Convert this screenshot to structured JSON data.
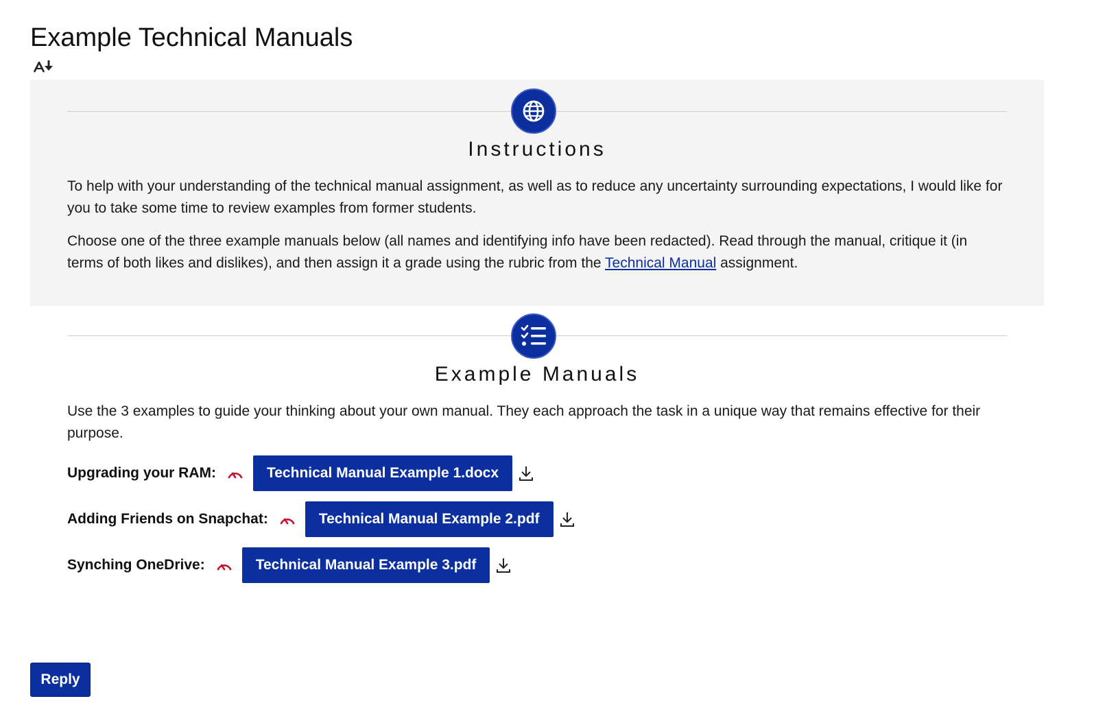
{
  "page": {
    "title": "Example Technical Manuals"
  },
  "icons": {
    "accessibility": "immersive-reader-icon",
    "instructions": "globe-icon",
    "examples": "checklist-icon",
    "preview": "preview-icon",
    "download": "download-icon"
  },
  "instructions": {
    "heading": "Instructions",
    "paragraph1": "To help with your understanding of the technical manual assignment, as well as to reduce any uncertainty surrounding expectations, I would like for you to take some time to review examples from former students.",
    "paragraph2_before": "Choose one of the three example manuals below (all names and identifying info have been redacted). Read through the manual, critique it (in terms of both likes and dislikes), and then assign it a grade using the rubric from the ",
    "paragraph2_link": "Technical Manual",
    "paragraph2_after": " assignment."
  },
  "examples": {
    "heading": "Example Manuals",
    "intro": "Use the 3 examples to guide your thinking about your own manual. They each approach the task in a unique way that remains effective for their purpose.",
    "files": [
      {
        "label": "Upgrading your RAM:",
        "file": "Technical Manual Example 1.docx"
      },
      {
        "label": "Adding Friends on Snapchat:",
        "file": "Technical Manual Example 2.pdf"
      },
      {
        "label": "Synching OneDrive:",
        "file": "Technical Manual Example 3.pdf"
      }
    ]
  },
  "actions": {
    "reply_label": "Reply"
  },
  "colors": {
    "accent": "#0b2f9e",
    "panel_bg": "#f4f4f4",
    "preview_icon": "#c8102e"
  }
}
